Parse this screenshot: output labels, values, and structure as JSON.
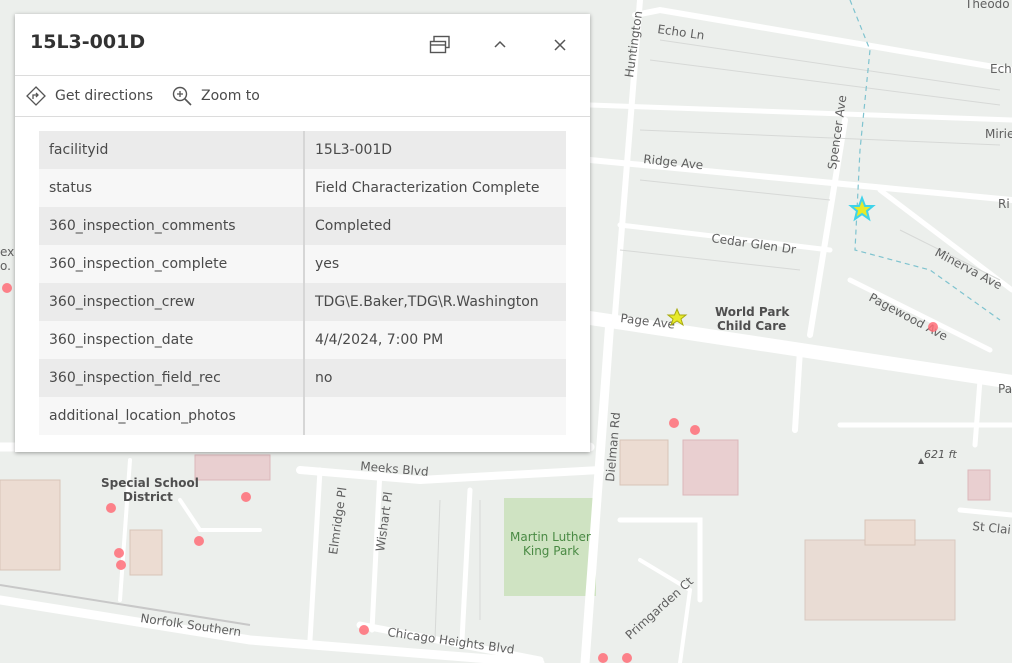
{
  "popup": {
    "title": "15L3-001D",
    "actions": {
      "directions": "Get directions",
      "zoom": "Zoom to"
    },
    "attributes": [
      {
        "key": "facilityid",
        "value": "15L3-001D"
      },
      {
        "key": "status",
        "value": "Field Characterization Complete"
      },
      {
        "key": "360_inspection_comments",
        "value": "Completed"
      },
      {
        "key": "360_inspection_complete",
        "value": "yes"
      },
      {
        "key": "360_inspection_crew",
        "value": "TDG\\E.Baker,TDG\\R.Washington"
      },
      {
        "key": "360_inspection_date",
        "value": "4/4/2024, 7:00 PM"
      },
      {
        "key": "360_inspection_field_rec",
        "value": "no"
      },
      {
        "key": "additional_location_photos",
        "value": ""
      }
    ]
  },
  "map": {
    "streets": [
      "Echo Ln",
      "Huntington",
      "Spencer Ave",
      "Ridge Ave",
      "Cedar Glen Dr",
      "Minerva Ave",
      "Pagewood Ave",
      "Page Ave",
      "Meeks Blvd",
      "Dielman Rd",
      "Elmridge Pl",
      "Wishart Pl",
      "Primgarden Ct",
      "Chicago Heights Blvd",
      "Norfolk Southern",
      "St Clai",
      "Mirie",
      "Ech",
      "Ri",
      "Pa",
      "Theodo"
    ],
    "pois": [
      "World Park",
      "Child Care",
      "Special School",
      "District",
      "Martin Luther",
      "King Park"
    ],
    "elevation": "621 ft",
    "left_edge": [
      "ex",
      "o."
    ]
  },
  "colors": {
    "highlight_star": "#3fd3ea",
    "feature_star": "#e8ea2a",
    "point": "#ff5a6a",
    "park": "#cfe3c2"
  }
}
